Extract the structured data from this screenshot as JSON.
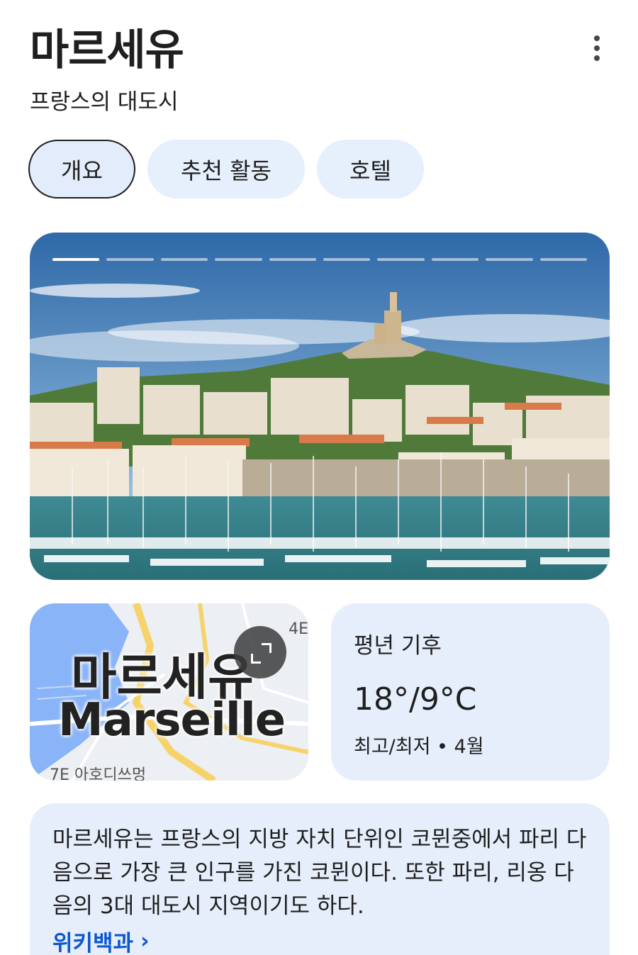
{
  "header": {
    "title": "마르세유",
    "subtitle": "프랑스의 대도시"
  },
  "tabs": [
    {
      "label": "개요",
      "active": true
    },
    {
      "label": "추천 활동",
      "active": false
    },
    {
      "label": "호텔",
      "active": false
    }
  ],
  "gallery": {
    "image_count": 10,
    "current_index": 1,
    "image": "marseille-old-port-photo"
  },
  "map": {
    "label_native": "마르세유",
    "label_latin": "Marseille",
    "corner_label_top": "4E",
    "corner_label_bottom": "7E 아호디쓰멍"
  },
  "climate": {
    "title": "평년 기후",
    "temp": "18°/9°C",
    "sub": "최고/최저 • 4월"
  },
  "description": {
    "text": "마르세유는 프랑스의 지방 자치 단위인 코뮌중에서 파리 다음으로 가장 큰 인구를 가진 코뮌이다. 또한 파리, 리옹 다음의 3대 대도시 지역이기도 하다.",
    "source_link": "위키백과",
    "link_chevron": "›"
  },
  "colors": {
    "chip_bg": "#e6effc",
    "card_bg": "#e6eefb",
    "link": "#0b57d0"
  }
}
